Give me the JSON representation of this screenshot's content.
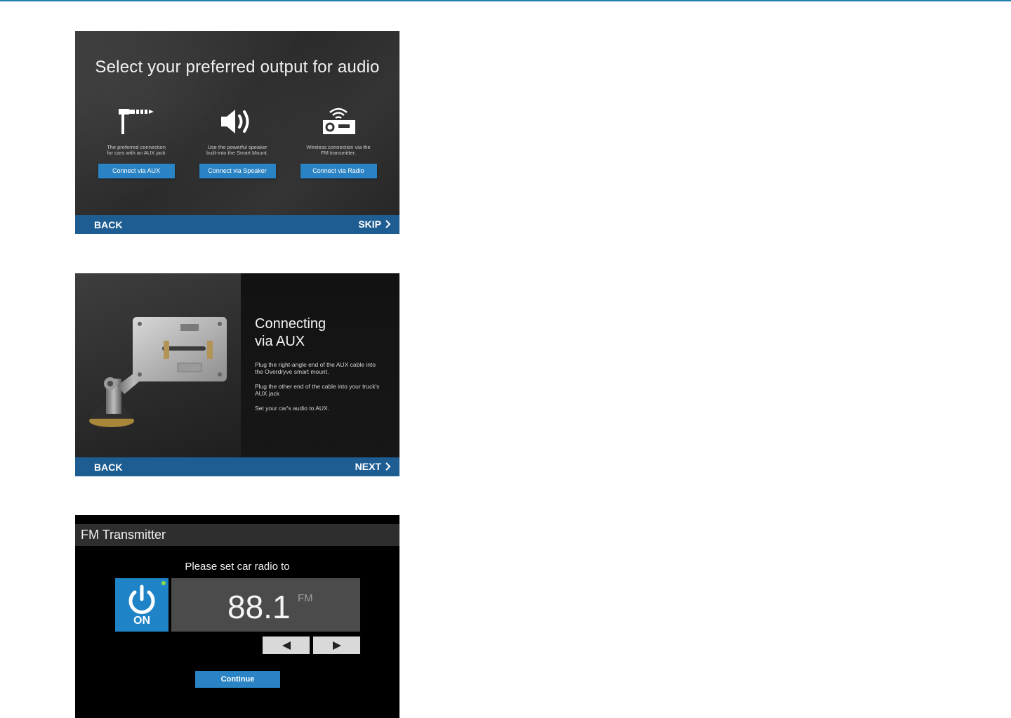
{
  "screen1": {
    "title": "Select your preferred output for audio",
    "options": [
      {
        "desc_line1": "The preferred connection",
        "desc_line2": "for cars with an AUX jack",
        "button": "Connect via AUX",
        "icon": "aux-jack-icon"
      },
      {
        "desc_line1": "Use the powerful speaker",
        "desc_line2": "built-into the Smart Mount.",
        "button": "Connect via Speaker",
        "icon": "speaker-icon"
      },
      {
        "desc_line1": "Wireless connection via the",
        "desc_line2": "FM transmitter.",
        "button": "Connect via Radio",
        "icon": "radio-icon"
      }
    ],
    "nav": {
      "back": "BACK",
      "forward": "SKIP"
    }
  },
  "screen2": {
    "heading_line1": "Connecting",
    "heading_line2": "via AUX",
    "p1_line1": "Plug the right-angle end of the AUX cable into",
    "p1_line2": "the Overdryve smart mount.",
    "p2_line1": "Plug the other end of the cable into your truck's",
    "p2_line2": "AUX jack",
    "p3": "Set your car's audio to AUX.",
    "nav": {
      "back": "BACK",
      "forward": "NEXT"
    }
  },
  "screen3": {
    "header": "FM Transmitter",
    "prompt": "Please set car radio to",
    "power_label": "ON",
    "frequency": "88.1",
    "band": "FM",
    "continue": "Continue"
  },
  "colors": {
    "accent": "#2a83c5",
    "navbar": "#1e5d92",
    "status_on": "#8bd94e"
  }
}
